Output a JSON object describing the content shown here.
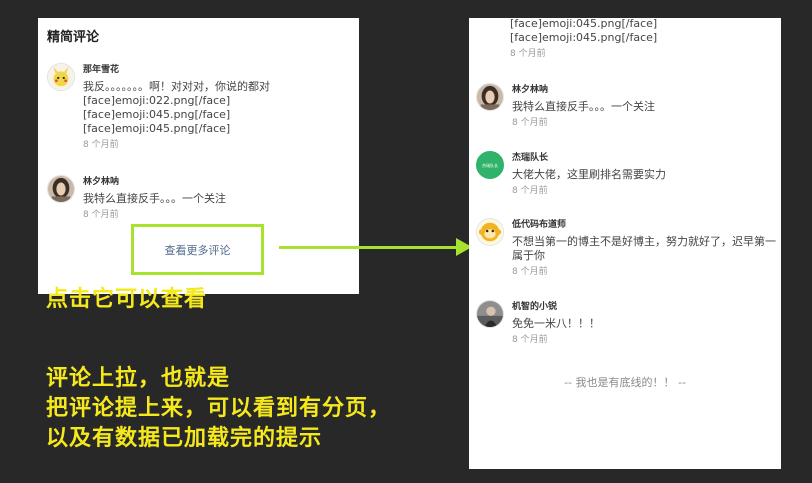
{
  "left_panel": {
    "title": "精简评论",
    "comments": [
      {
        "name": "那年雪花",
        "lines": [
          "我反。。。。。。。啊！对对对，你说的都对",
          "[face]emoji:022.png[/face]",
          "[face]emoji:045.png[/face]",
          "[face]emoji:045.png[/face]"
        ],
        "time": "8 个月前",
        "avatar_icon": "pikachu-avatar-icon"
      },
      {
        "name": "林夕林呐",
        "text": "我特么直接反手。。。一个关注",
        "time": "8 个月前",
        "avatar_icon": "girl-portrait-avatar-icon"
      }
    ],
    "more_button": "查看更多评论"
  },
  "right_panel": {
    "top_lines": [
      "[face]emoji:045.png[/face]",
      "[face]emoji:045.png[/face]"
    ],
    "top_time": "8 个月前",
    "comments": [
      {
        "name": "林夕林呐",
        "text": "我特么直接反手。。。一个关注",
        "time": "8 个月前",
        "avatar_icon": "girl-portrait-avatar-icon"
      },
      {
        "name": "杰瑞队长",
        "text": "大佬大佬，这里刷排名需要实力",
        "time": "8 个月前",
        "avatar_icon": "green-logo-avatar-icon",
        "avatar_text": "杰瑞队长"
      },
      {
        "name": "低代码布道师",
        "text": "不想当第一的博主不是好博主，努力就好了，迟早第一属于你",
        "time": "8 个月前",
        "avatar_icon": "yellow-monkey-avatar-icon"
      },
      {
        "name": "机智的小锐",
        "text": "免免一米八！！！",
        "time": "8 个月前",
        "avatar_icon": "person-photo-avatar-icon"
      }
    ],
    "end_hint": "-- 我也是有底线的！！ --"
  },
  "captions": [
    "点击它可以查看",
    "评论上拉，也就是",
    "把评论提上来，可以看到有分页，",
    "以及有数据已加载完的提示"
  ],
  "colors": {
    "background": "#282828",
    "highlight": "#a6e22e",
    "caption": "#f5e91c",
    "link": "#4f6b8e"
  }
}
